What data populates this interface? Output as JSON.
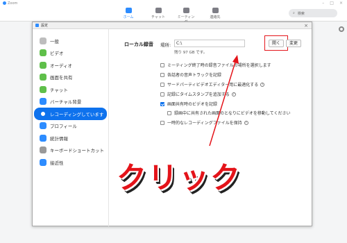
{
  "app": {
    "title": "Zoom"
  },
  "nav": {
    "items": [
      {
        "label": "ホーム",
        "icon": "home-icon",
        "active": true
      },
      {
        "label": "チャット",
        "icon": "chat-icon",
        "active": false
      },
      {
        "label": "ミーティング",
        "icon": "clock-icon",
        "active": false
      },
      {
        "label": "連絡先",
        "icon": "contacts-icon",
        "active": false
      }
    ],
    "search_label": "検索"
  },
  "settings": {
    "title": "設定",
    "sidebar": [
      {
        "label": "一般",
        "icon": "gear-icon",
        "color": "#bdbdbd"
      },
      {
        "label": "ビデオ",
        "icon": "video-icon",
        "color": "#5fbf4a"
      },
      {
        "label": "オーディオ",
        "icon": "headphone-icon",
        "color": "#5fbf4a"
      },
      {
        "label": "画面を共有",
        "icon": "share-screen-icon",
        "color": "#5fbf4a"
      },
      {
        "label": "チャット",
        "icon": "chat-icon",
        "color": "#5fbf4a"
      },
      {
        "label": "バーチャル背景",
        "icon": "virtual-background-icon",
        "color": "#2d8cff"
      },
      {
        "label": "レコーディングしています",
        "icon": "record-icon",
        "color": "#ffffff",
        "active": true
      },
      {
        "label": "プロフィール",
        "icon": "profile-icon",
        "color": "#2d8cff"
      },
      {
        "label": "統計情報",
        "icon": "statistics-icon",
        "color": "#2d8cff"
      },
      {
        "label": "キーボードショートカット",
        "icon": "keyboard-icon",
        "color": "#999999"
      },
      {
        "label": "接近性",
        "icon": "accessibility-icon",
        "color": "#2d8cff"
      }
    ],
    "recording": {
      "heading": "ローカル録音",
      "location_label": "場所:",
      "path_value": "C:\\",
      "open_button": "開く",
      "change_button": "変更",
      "free_space": "残り 97 GB です。",
      "options": [
        {
          "label": "ミーティング終了時の録音ファイルの場所を選択します",
          "checked": false,
          "help": false
        },
        {
          "label": "各話者の音声トラックを記録",
          "checked": false,
          "help": false
        },
        {
          "label": "サードパーティビデオエディター用に最適化する",
          "checked": false,
          "help": true
        },
        {
          "label": "記録にタイムスタンプを追加する",
          "checked": false,
          "help": true
        },
        {
          "label": "画面共有時のビデオを記録",
          "checked": true,
          "help": false
        },
        {
          "label": "録画中に共有された画面のとなりにビデオを移動してください",
          "checked": false,
          "help": false,
          "indent": true
        },
        {
          "label": "一時的なレコーディングファイルを保持",
          "checked": false,
          "help": true
        }
      ]
    }
  },
  "annotation": {
    "text": "クリック",
    "color": "#e4141a"
  }
}
